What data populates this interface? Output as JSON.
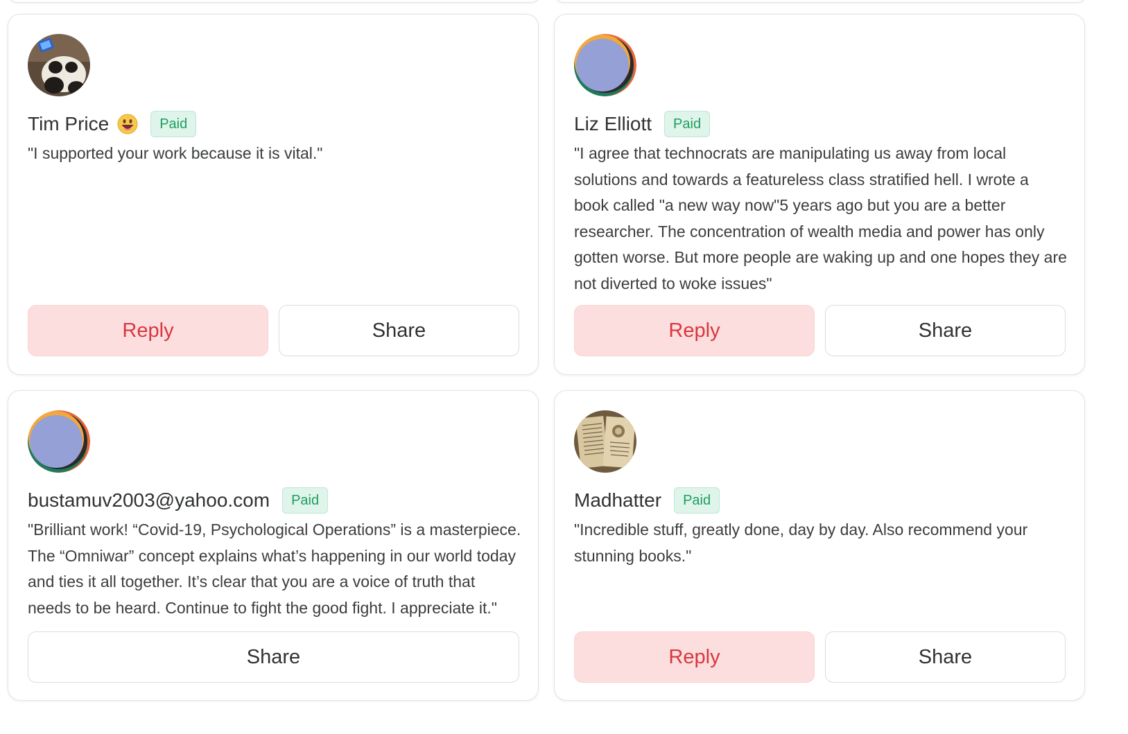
{
  "cards": [
    {
      "name": "Tim Price",
      "emoji": "grinning-face-icon",
      "badge": "Paid",
      "message": "\"I supported your work because it is vital.\"",
      "reply_label": "Reply",
      "share_label": "Share"
    },
    {
      "name": "Liz Elliott",
      "badge": "Paid",
      "message": "\"I agree that technocrats are manipulating us away from local solutions and towards a featureless class stratified hell. I wrote a book called \"a new way now\"5 years ago but you are a better researcher. The concentration of wealth media and power has only gotten worse. But more people are waking up and one hopes they are not diverted to woke issues\"",
      "reply_label": "Reply",
      "share_label": "Share"
    },
    {
      "name": "bustamuv2003@yahoo.com",
      "badge": "Paid",
      "message": "\"Brilliant work! “Covid-19, Psychological Operations” is a masterpiece. The “Omniwar” concept explains what’s happening in our world today and ties it all together. It’s clear that you are a voice of truth that needs to be heard. Continue to fight the good fight. I appreciate it.\"",
      "share_label": "Share"
    },
    {
      "name": "Madhatter",
      "badge": "Paid",
      "message": "\"Incredible stuff, greatly done, day by day. Also recommend your stunning books.\"",
      "reply_label": "Reply",
      "share_label": "Share"
    }
  ],
  "colors": {
    "reply_bg": "#fddede",
    "reply_text": "#d7373f",
    "badge_bg": "#dff4ea",
    "badge_text": "#1e9e5f"
  }
}
